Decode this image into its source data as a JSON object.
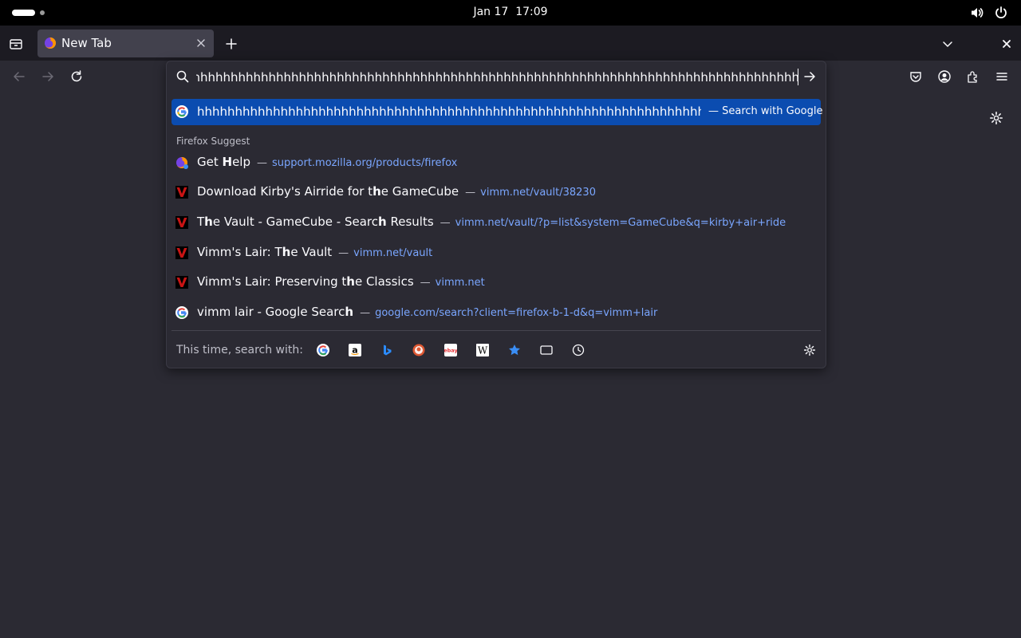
{
  "topbar": {
    "date": "Jan 17",
    "time": "17:09",
    "icons": [
      "activities-indicator",
      "volume-icon",
      "power-icon"
    ]
  },
  "browser": {
    "tab": {
      "title": "New Tab"
    },
    "urlbar": {
      "value": "hhhhhhhhhhhhhhhhhhhhhhhhhhhhhhhhhhhhhhhhhhhhhhhhhhhhhhhhhhhhhhhhhhhhhhhhhhhhhhhhhhhhhhhhhhhhhhhhhhhhhhhhhhhhhhh"
    },
    "colors": {
      "selection": "#0b4cb0",
      "link": "#7aa6ff",
      "background": "#2b2a33"
    }
  },
  "dropdown": {
    "selected": {
      "text": "hhhhhhhhhhhhhhhhhhhhhhhhhhhhhhhhhhhhhhhhhhhhhhhhhhhhhhhhhhhhhhhhhhhhhhhhhhhhhhhhhhhhhhhhhhhhhhhhhhhhhhhhhhhhhh",
      "action": "— Search with Google"
    },
    "group_label": "Firefox Suggest",
    "items": [
      {
        "pre": "Get ",
        "bold": "H",
        "post": "elp",
        "url": "support.mozilla.org/products/firefox",
        "icon": "firefox-icon"
      },
      {
        "pre": "Download Kirby's Airride for t",
        "bold": "h",
        "post": "e GameCube",
        "url": "vimm.net/vault/38230",
        "icon": "vimm-icon"
      },
      {
        "pre": "T",
        "bold": "h",
        "post": "e Vault - GameCube - Searc",
        "bold2": "h",
        "post2": " Results",
        "url": "vimm.net/vault/?p=list&system=GameCube&q=kirby+air+ride",
        "icon": "vimm-icon"
      },
      {
        "pre": "Vimm's Lair: T",
        "bold": "h",
        "post": "e Vault",
        "url": "vimm.net/vault",
        "icon": "vimm-icon"
      },
      {
        "pre": "Vimm's Lair: Preserving t",
        "bold": "h",
        "post": "e Classics",
        "url": "vimm.net",
        "icon": "vimm-icon"
      },
      {
        "pre": "vimm lair - Google Searc",
        "bold": "h",
        "post": "",
        "url": "google.com/search?client=firefox-b-1-d&q=vimm+lair",
        "icon": "google-icon"
      }
    ],
    "search_with_label": "This time, search with:",
    "engines": [
      "google-icon",
      "amazon-icon",
      "bing-icon",
      "duckduckgo-icon",
      "ebay-icon",
      "wikipedia-icon",
      "bookmarks-icon",
      "tabs-icon",
      "history-icon"
    ]
  }
}
